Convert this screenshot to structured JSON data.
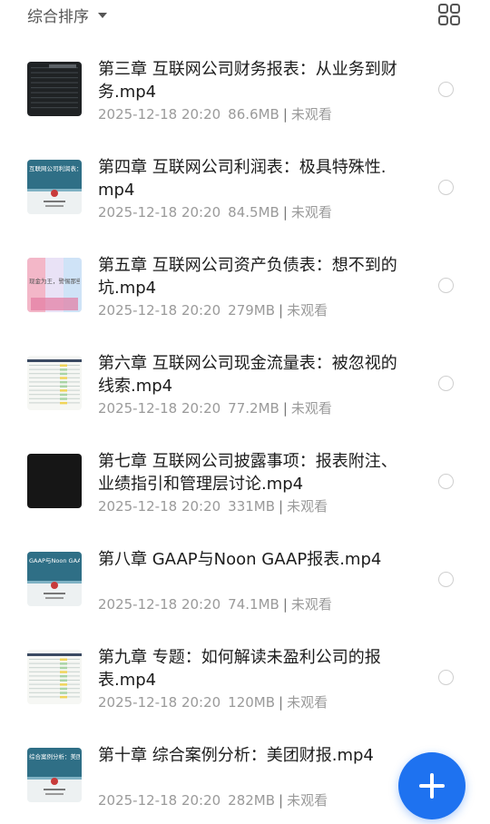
{
  "toolbar": {
    "sort_label": "综合排序",
    "sort_caret_icon": "caret-down-icon",
    "view_toggle_icon": "grid-view-icon"
  },
  "files": [
    {
      "title": "第三章 互联网公司财务报表：从业务到财务.mp4",
      "date": "2025-12-18 20:20",
      "size": "86.6MB",
      "status": "未观看",
      "thumb_style": "dark-sheet"
    },
    {
      "title": "第四章 互联网公司利润表：极具特殊性.mp4",
      "date": "2025-12-18 20:20",
      "size": "84.5MB",
      "status": "未观看",
      "thumb_style": "teal-slide",
      "thumb_text": "互联网公司利润表：极"
    },
    {
      "title": "第五章 互联网公司资产负债表：想不到的坑.mp4",
      "date": "2025-12-18 20:20",
      "size": "279MB",
      "status": "未观看",
      "thumb_style": "pastel-slide",
      "thumb_text": "现金为王，警惕那些"
    },
    {
      "title": "第六章 互联网公司现金流量表：被忽视的线索.mp4",
      "date": "2025-12-18 20:20",
      "size": "77.2MB",
      "status": "未观看",
      "thumb_style": "table-sheet"
    },
    {
      "title": "第七章 互联网公司披露事项：报表附注、业绩指引和管理层讨论.mp4",
      "date": "2025-12-18 20:20",
      "size": "331MB",
      "status": "未观看",
      "thumb_style": "black"
    },
    {
      "title": "第八章 GAAP与Noon GAAP报表.mp4",
      "date": "2025-12-18 20:20",
      "size": "74.1MB",
      "status": "未观看",
      "thumb_style": "teal-slide",
      "thumb_text": "GAAP与Noon GAA"
    },
    {
      "title": "第九章 专题：如何解读未盈利公司的报表.mp4",
      "date": "2025-12-18 20:20",
      "size": "120MB",
      "status": "未观看",
      "thumb_style": "table-sheet"
    },
    {
      "title": "第十章 综合案例分析：美团财报.mp4",
      "date": "2025-12-18 20:20",
      "size": "282MB",
      "status": "未观看",
      "thumb_style": "teal-slide",
      "thumb_text": "综合案例分析：美团"
    }
  ],
  "fab": {
    "icon": "plus-icon"
  },
  "colors": {
    "accent": "#1e72f0",
    "meta": "#9a9a9a",
    "radio": "#cfcfcf"
  }
}
